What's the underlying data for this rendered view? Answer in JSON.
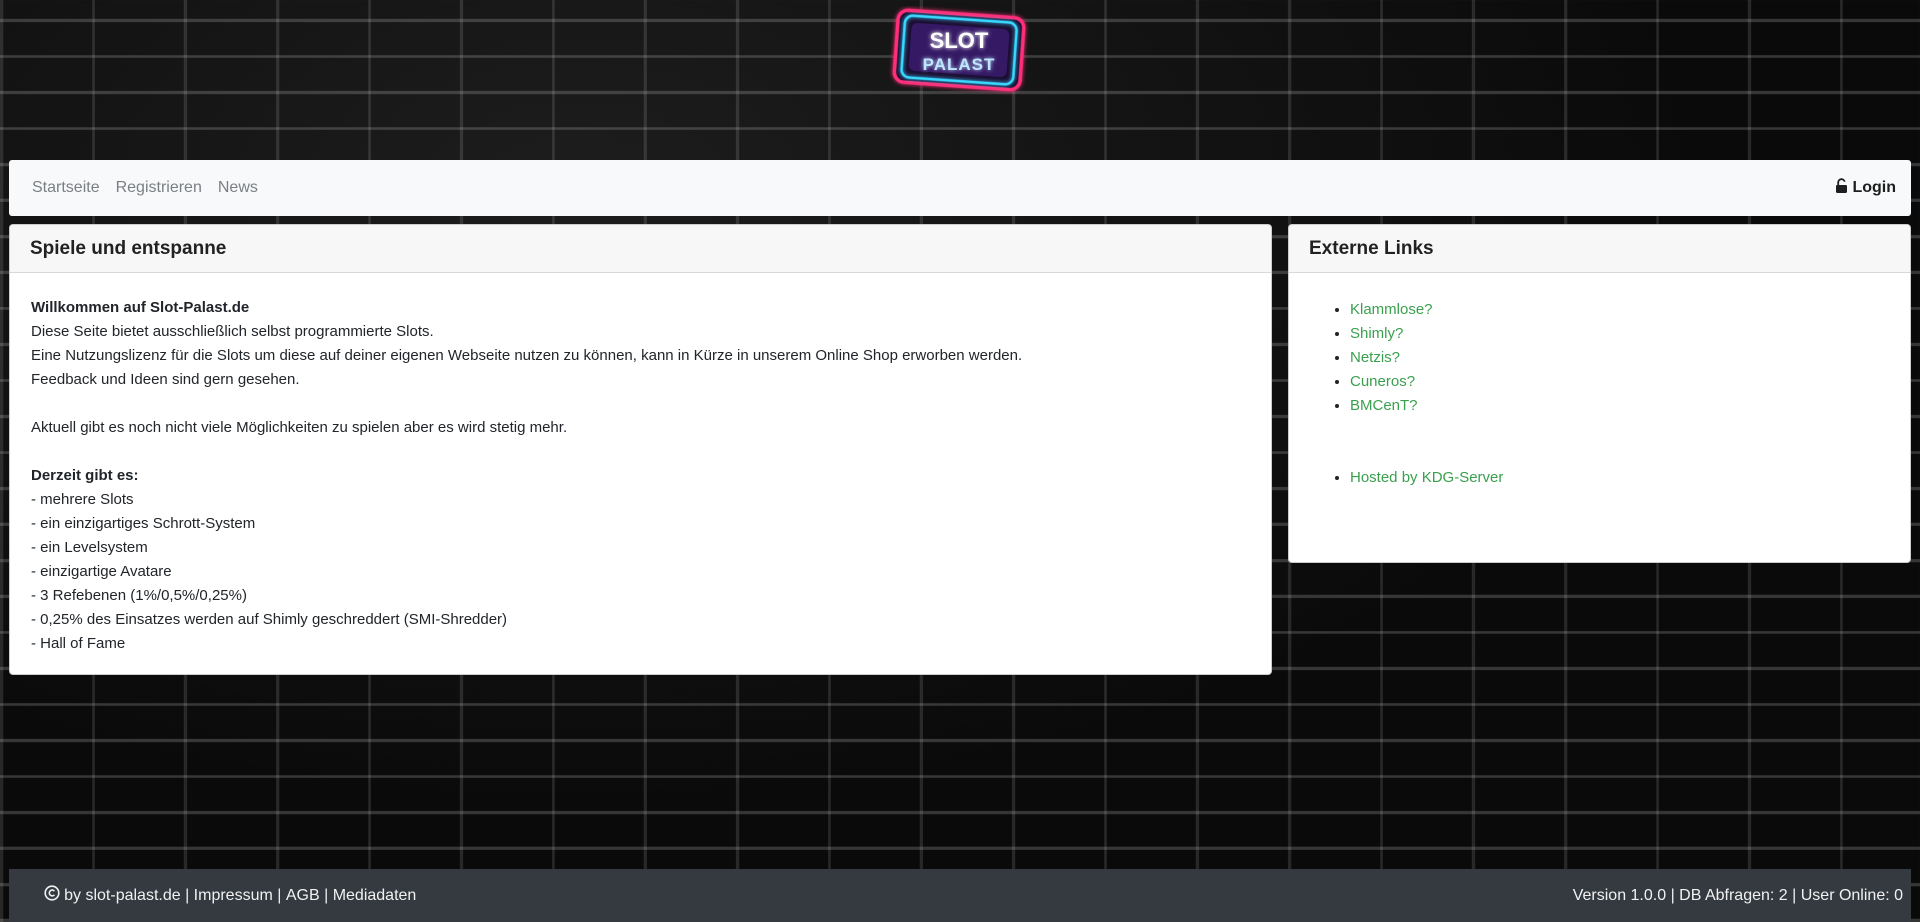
{
  "logo": {
    "line1": "SLOT",
    "line2": "PALAST"
  },
  "nav": {
    "links": [
      "Startseite",
      "Registrieren",
      "News"
    ],
    "login_label": "Login"
  },
  "main_card": {
    "title": "Spiele und entspanne",
    "welcome": "Willkommen auf Slot-Palast.de",
    "intro_lines": [
      "Diese Seite bietet ausschließlich selbst programmierte Slots.",
      "Eine Nutzungslizenz für die Slots um diese auf deiner eigenen Webseite nutzen zu können, kann in Kürze in unserem Online Shop erworben werden.",
      "Feedback und Ideen sind gern gesehen."
    ],
    "status_line": "Aktuell gibt es noch nicht viele Möglichkeiten zu spielen aber es wird stetig mehr.",
    "features_heading": "Derzeit gibt es:",
    "features": [
      "- mehrere Slots",
      "- ein einzigartiges Schrott-System",
      "- ein Levelsystem",
      "- einzigartige Avatare",
      "- 3 Refebenen (1%/0,5%/0,25%)",
      "- 0,25% des Einsatzes werden auf Shimly geschreddert (SMI-Shredder)",
      "- Hall of Fame"
    ]
  },
  "side_card": {
    "title": "Externe Links",
    "links": [
      "Klammlose?",
      "Shimly?",
      "Netzis?",
      "Cuneros?",
      "BMCenT?"
    ],
    "hosted_label": "Hosted by KDG-Server"
  },
  "footer": {
    "copyright_text": " by slot-palast.de",
    "separator": " | ",
    "links": [
      "Impressum",
      "AGB",
      "Mediadaten"
    ],
    "version": "Version 1.0.0",
    "db_queries": "DB Abfragen: 2",
    "users_online": "User Online: 0"
  },
  "colors": {
    "link_green": "#3aa04e",
    "footer_bg": "#343a40",
    "navbar_bg": "#f8f9fa",
    "neon_pink": "#ff2d78",
    "neon_cyan": "#39d8ff"
  },
  "icons": [
    "unlock-icon",
    "copyright-icon",
    "slot-palast-logo"
  ]
}
